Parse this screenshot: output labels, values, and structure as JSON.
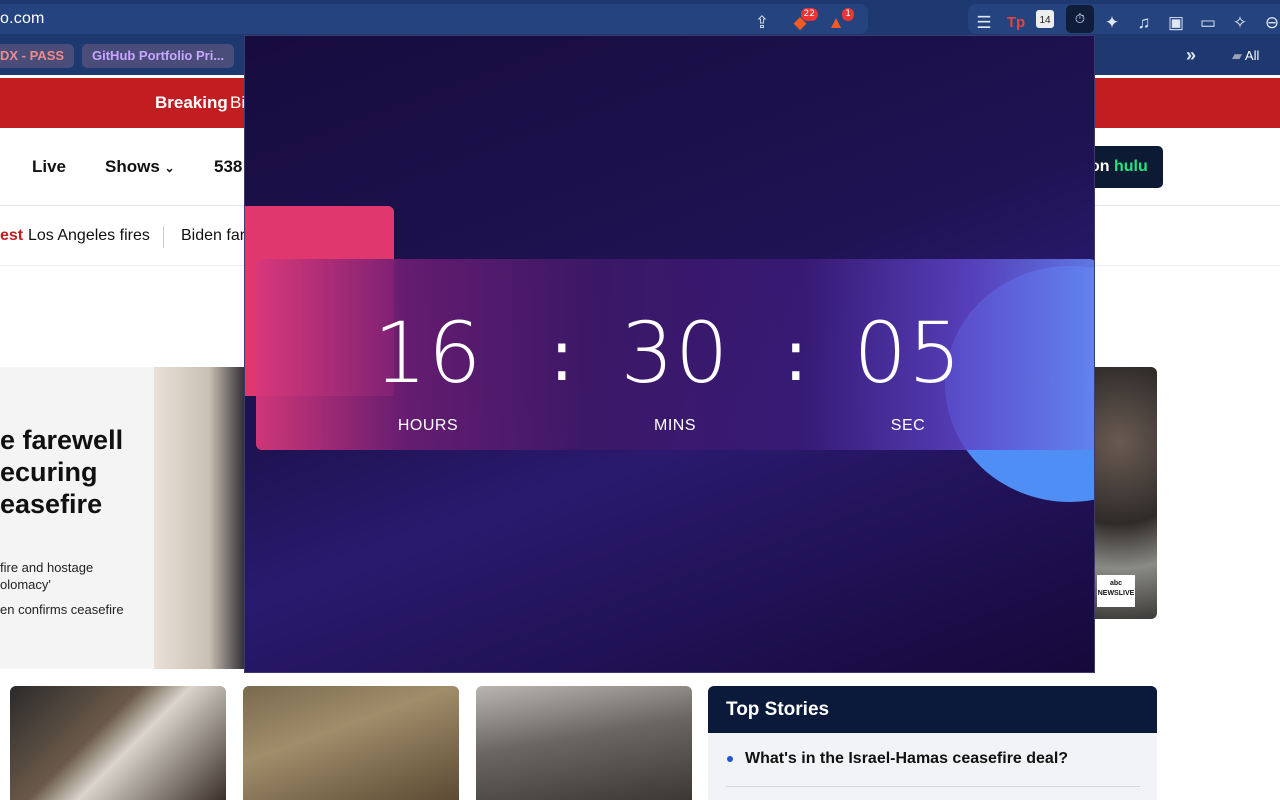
{
  "browser": {
    "url": "o.com",
    "shields_count": "22",
    "rewards_count": "1",
    "calendar_day": "14",
    "bookmarks": [
      "DX - PASS",
      "GitHub Portfolio Pri..."
    ],
    "bookmarks_overflow": "»",
    "all_bookmarks": "All B"
  },
  "page": {
    "breaking_label": "Breaking",
    "breaking_text": "Bi",
    "nav": [
      "Live",
      "Shows",
      "538"
    ],
    "hulu_prefix": "on",
    "hulu_brand": "hulu",
    "trending_label": "est",
    "trending": [
      "Los Angeles fires",
      "Biden far"
    ],
    "lead_title_lines": [
      "e farewell",
      "ecuring",
      "easefire"
    ],
    "lead_sub_lines": [
      "fire and hostage",
      "olomacy'",
      "en confirms ceasefire"
    ],
    "abc_logo": "abc NEWSLIVE",
    "top_stories_heading": "Top Stories",
    "top_story_1": "What's in the Israel-Hamas ceasefire deal?"
  },
  "timer": {
    "hours": "16",
    "mins": "30",
    "sec": "05",
    "separator": ":",
    "hours_label": "HOURS",
    "mins_label": "MINS",
    "sec_label": "SEC"
  },
  "colors": {
    "chrome": "#1d3970",
    "breaking": "#c21d21",
    "popup_pink": "#e0376f",
    "popup_blue": "#4f8ff5",
    "popup_bg": "#1f1354"
  }
}
